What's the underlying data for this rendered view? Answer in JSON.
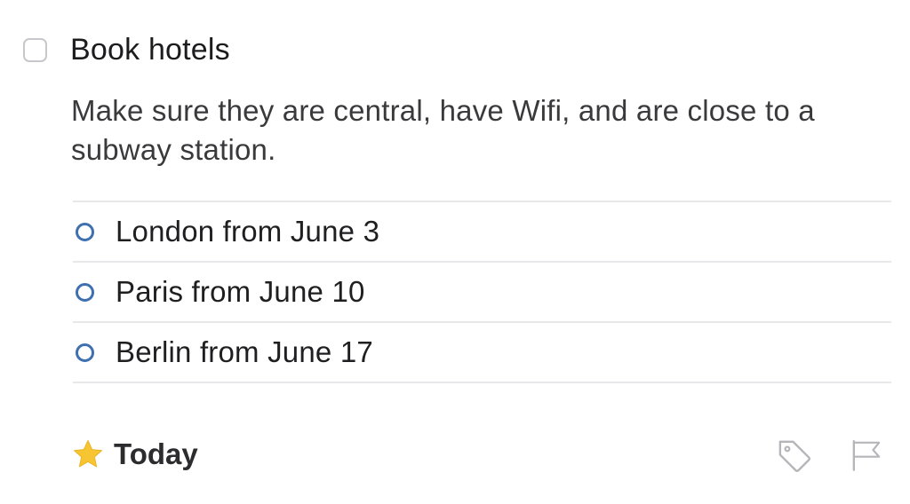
{
  "task": {
    "title": "Book hotels",
    "notes": "Make sure they are central, have Wifi, and are close to a subway station.",
    "completed": false
  },
  "checklist": [
    {
      "label": "London from June 3",
      "completed": false
    },
    {
      "label": "Paris from June 10",
      "completed": false
    },
    {
      "label": "Berlin from June 17",
      "completed": false
    }
  ],
  "when": {
    "label": "Today",
    "icon": "star-icon"
  },
  "actions": {
    "tag_icon": "tag-icon",
    "flag_icon": "flag-icon"
  },
  "colors": {
    "checklist_circle": "#3e6fb0",
    "star": "#f7c531",
    "divider": "#e8e8ea",
    "icon_gray": "#b5b5ba"
  }
}
